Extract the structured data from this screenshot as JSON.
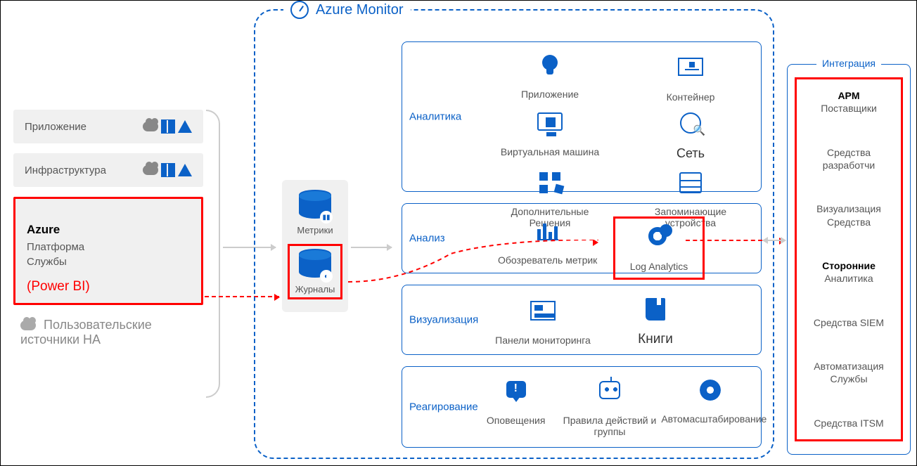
{
  "monitor_title": "Azure Monitor",
  "sources": {
    "app": "Приложение",
    "infra": "Инфраструктура",
    "azure_title": "Azure",
    "azure_sub1": "Платформа",
    "azure_sub2": "Службы",
    "powerbi": "(Power BI)",
    "custom": "Пользовательские источники НА"
  },
  "storage": {
    "metrics": "Метрики",
    "logs": "Журналы"
  },
  "sections": {
    "analytics": {
      "label": "Аналитика",
      "items": [
        "Приложение",
        "Контейнер",
        "Виртуальная машина",
        "Сеть",
        "Дополнительные Решения",
        "Запоминающие устройства"
      ]
    },
    "analysis": {
      "label": "Анализ",
      "items": [
        "Обозреватель метрик",
        "Log Analytics"
      ]
    },
    "viz": {
      "label": "Визуализация",
      "items": [
        "Панели мониторинга",
        "Книги"
      ]
    },
    "respond": {
      "label": "Реагирование",
      "items": [
        "Оповещения",
        "Правила действий и группы",
        "Автомасштабирование"
      ]
    }
  },
  "integration": {
    "title": "Интеграция",
    "items": [
      {
        "t": "APM",
        "s": "Поставщики"
      },
      {
        "t": "",
        "s": "Средства разработчи"
      },
      {
        "t": "",
        "s": "Визуализация Средства"
      },
      {
        "t": "Сторонние",
        "s": "Аналитика"
      },
      {
        "t": "",
        "s": "Средства SIEM"
      },
      {
        "t": "",
        "s": "Автоматизация Службы"
      },
      {
        "t": "",
        "s": "Средства ITSM"
      }
    ]
  }
}
